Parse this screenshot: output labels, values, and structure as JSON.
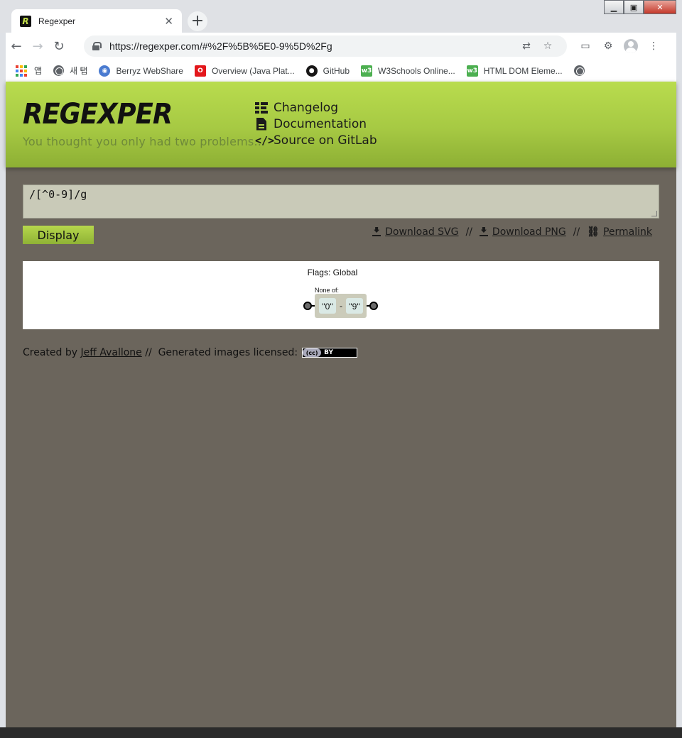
{
  "browser": {
    "tab_title": "Regexper",
    "tab_favicon_letter": "R",
    "url": "https://regexper.com/#%2F%5B%5E0-9%5D%2Fg",
    "new_tab_symbol": "+",
    "close_tab_symbol": "✕",
    "bookmarks": [
      {
        "label": "앱",
        "icon": "apps-icon"
      },
      {
        "label": "새 탭",
        "icon": "globe-icon"
      },
      {
        "label": "Berryz WebShare",
        "icon": "berryz-icon"
      },
      {
        "label": "Overview (Java Plat...",
        "icon": "oracle-icon"
      },
      {
        "label": "GitHub",
        "icon": "github-icon"
      },
      {
        "label": "W3Schools Online...",
        "icon": "w3schools-icon"
      },
      {
        "label": "HTML DOM Eleme...",
        "icon": "w3schools-icon"
      }
    ]
  },
  "header": {
    "logo": "REGEXPER",
    "tagline": "You thought you only had two problems...",
    "nav": [
      {
        "label": "Changelog",
        "icon": "list-icon"
      },
      {
        "label": "Documentation",
        "icon": "document-icon"
      },
      {
        "label": "Source on GitLab",
        "icon": "code-icon"
      }
    ]
  },
  "main": {
    "regex_value": "/[^0-9]/g",
    "display_button": "Display",
    "links": {
      "download_svg": "Download SVG",
      "download_png": "Download PNG",
      "permalink": "Permalink",
      "separator": "//"
    }
  },
  "diagram": {
    "flags": "Flags: Global",
    "set_label": "None of:",
    "range_start": "\"0\"",
    "range_dash": "-",
    "range_end": "\"9\""
  },
  "footer": {
    "created_by": "Created by",
    "author": "Jeff Avallone",
    "separator": "//",
    "licensed": "Generated images licensed:",
    "badge_cc": "(cc)",
    "badge_by": "BY"
  },
  "colors": {
    "header_green": "#a6c943",
    "page_background": "#6b655c",
    "input_background": "#c9cab8"
  }
}
